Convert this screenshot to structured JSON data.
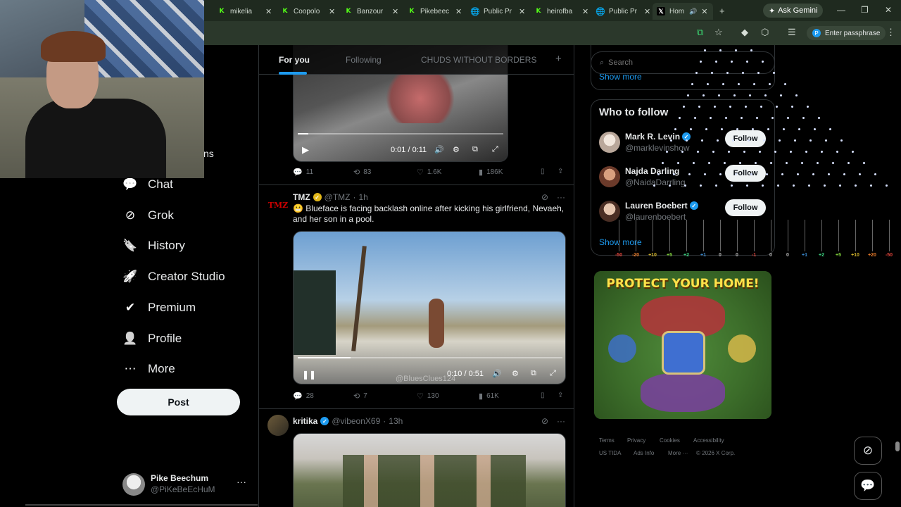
{
  "browser": {
    "tabs": [
      {
        "label": "mikelia",
        "icon": "kick-icon"
      },
      {
        "label": "Coopolo",
        "icon": "kick-icon"
      },
      {
        "label": "Banzour",
        "icon": "kick-icon"
      },
      {
        "label": "Pikebeec",
        "icon": "kick-icon"
      },
      {
        "label": "Public Pr",
        "icon": "globe-icon"
      },
      {
        "label": "heirofba",
        "icon": "kick-icon"
      },
      {
        "label": "Public Pr",
        "icon": "globe-icon"
      },
      {
        "label": "Hom",
        "icon": "x-icon"
      }
    ],
    "ask_gemini": "Ask Gemini",
    "passphrase": "Enter passphrase"
  },
  "nav": {
    "partial_label": "ns",
    "items": [
      {
        "label": "Chat",
        "icon": "chat-icon"
      },
      {
        "label": "Grok",
        "icon": "grok-icon"
      },
      {
        "label": "History",
        "icon": "bookmark-icon"
      },
      {
        "label": "Creator Studio",
        "icon": "rocket-icon"
      },
      {
        "label": "Premium",
        "icon": "verified-icon"
      },
      {
        "label": "Profile",
        "icon": "person-icon"
      },
      {
        "label": "More",
        "icon": "more-circle-icon"
      }
    ],
    "post_label": "Post",
    "account": {
      "name": "Pike Beechum",
      "handle": "@PiKeBeEcHuM"
    }
  },
  "timeline": {
    "tabs": [
      "For you",
      "Following",
      "CHUDS WITHOUT BORDERS"
    ],
    "add_tab": "+",
    "posts": [
      {
        "video_time": "0:01 / 0:11",
        "video_progress": 0.05,
        "stats": {
          "replies": "11",
          "reposts": "83",
          "likes": "1.6K",
          "views": "186K"
        }
      },
      {
        "author": "TMZ",
        "handle": "@TMZ",
        "time": "1h",
        "text": "😬 Blueface is facing backlash online after kicking his girlfriend, Nevaeh, and her son in a pool.",
        "video_time": "0:10 / 0:51",
        "video_progress": 0.2,
        "watermark": "@BluesClues124",
        "stats": {
          "replies": "28",
          "reposts": "7",
          "likes": "130",
          "views": "61K"
        }
      },
      {
        "author": "kritika",
        "handle": "@vibeonX69",
        "time": "13h"
      }
    ]
  },
  "sidebar": {
    "search_placeholder": "Search",
    "trends_show_more": "Show more",
    "who_to_follow": "Who to follow",
    "suggestions": [
      {
        "name": "Mark R. Levin",
        "handle": "@marklevinshow",
        "verified": true,
        "follow": "Follow"
      },
      {
        "name": "Najda Darling",
        "handle": "@NaidaDarrling",
        "verified": false,
        "follow": "Follow"
      },
      {
        "name": "Lauren Boebert",
        "handle": "@laurenboebert",
        "verified": true,
        "follow": "Follow"
      }
    ],
    "wtf_show_more": "Show more",
    "ad_title": "PROTECT YOUR HOME!",
    "footer": [
      "Terms",
      "Privacy",
      "Cookies",
      "Accessibility",
      "US TIDA",
      "Ads Info",
      "More ···",
      "© 2026 X Corp."
    ]
  },
  "overlay_scale": [
    "-50",
    "-20",
    "+10",
    "+5",
    "+2",
    "+1",
    "0",
    "0",
    "-1",
    "0",
    "0",
    "+1",
    "+2",
    "+5",
    "+10",
    "+20",
    "-50"
  ],
  "colors": {
    "accent": "#1d9bf0",
    "background": "#000000",
    "border": "#2f3336",
    "muted": "#71767b"
  }
}
